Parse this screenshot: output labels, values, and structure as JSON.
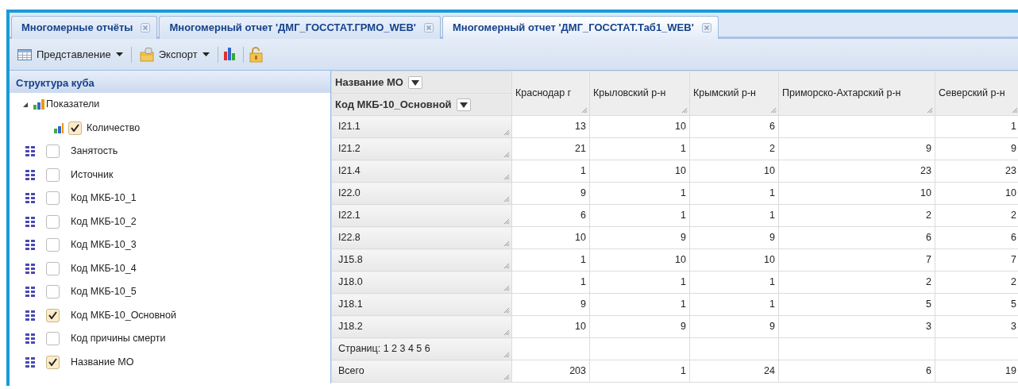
{
  "tabs": [
    {
      "label": "Многомерные отчёты",
      "selected": false
    },
    {
      "label": "Многомерный отчет 'ДМГ_ГОССТАТ.ГРМО_WEB'",
      "selected": false
    },
    {
      "label": "Многомерный отчет 'ДМГ_ГОССТАТ.Таб1_WEB'",
      "selected": true
    }
  ],
  "toolbar": [
    {
      "kind": "dropdown",
      "label": "Представление"
    },
    {
      "kind": "dropdown",
      "label": "Экспорт"
    },
    {
      "kind": "icon"
    },
    {
      "kind": "icon"
    }
  ],
  "sidebar": {
    "title": "Структура куба",
    "items": [
      {
        "kind": "group",
        "label": "Показатели",
        "expanded": true,
        "children": [
          {
            "kind": "measure",
            "label": "Количество",
            "checked": true
          }
        ]
      },
      {
        "kind": "dimension",
        "label": "Занятость",
        "checked": false
      },
      {
        "kind": "dimension",
        "label": "Источник",
        "checked": false
      },
      {
        "kind": "dimension",
        "label": "Код МКБ-10_1",
        "checked": false
      },
      {
        "kind": "dimension",
        "label": "Код МКБ-10_2",
        "checked": false
      },
      {
        "kind": "dimension",
        "label": "Код МКБ-10_3",
        "checked": false
      },
      {
        "kind": "dimension",
        "label": "Код МКБ-10_4",
        "checked": false
      },
      {
        "kind": "dimension",
        "label": "Код МКБ-10_5",
        "checked": false
      },
      {
        "kind": "dimension",
        "label": "Код МКБ-10_Основной",
        "checked": true
      },
      {
        "kind": "dimension",
        "label": "Код причины смерти",
        "checked": false
      },
      {
        "kind": "dimension",
        "label": "Название МО",
        "checked": true
      }
    ]
  },
  "table": {
    "column_field": "Название МО",
    "row_field": "Код МКБ-10_Основной",
    "columns": [
      "Краснодар г",
      "Крыловский р-н",
      "Крымский р-н",
      "Приморско-Ахтарский р-н",
      "Северский р-н"
    ],
    "rows": [
      {
        "label": "I21.1",
        "cells": [
          "13",
          "10",
          "6",
          "",
          "1"
        ]
      },
      {
        "label": "I21.2",
        "cells": [
          "21",
          "1",
          "2",
          "9",
          "9"
        ]
      },
      {
        "label": "I21.4",
        "cells": [
          "1",
          "10",
          "10",
          "23",
          "23"
        ]
      },
      {
        "label": "I22.0",
        "cells": [
          "9",
          "1",
          "1",
          "10",
          "10"
        ]
      },
      {
        "label": "I22.1",
        "cells": [
          "6",
          "1",
          "1",
          "2",
          "2"
        ]
      },
      {
        "label": "I22.8",
        "cells": [
          "10",
          "9",
          "9",
          "6",
          "6"
        ]
      },
      {
        "label": "J15.8",
        "cells": [
          "1",
          "10",
          "10",
          "7",
          "7"
        ]
      },
      {
        "label": "J18.0",
        "cells": [
          "1",
          "1",
          "1",
          "2",
          "2"
        ]
      },
      {
        "label": "J18.1",
        "cells": [
          "9",
          "1",
          "1",
          "5",
          "5"
        ]
      },
      {
        "label": "J18.2",
        "cells": [
          "10",
          "9",
          "9",
          "3",
          "3"
        ]
      },
      {
        "label": "Страниц: 1 2 3 4 5 6",
        "cells": [
          "",
          "",
          "",
          "",
          ""
        ]
      },
      {
        "label": "Всего",
        "cells": [
          "203",
          "1",
          "24",
          "6",
          "19"
        ]
      }
    ]
  }
}
